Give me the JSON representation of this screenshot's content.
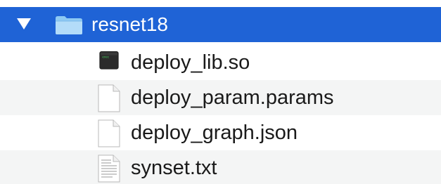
{
  "folder": {
    "name": "resnet18",
    "expanded": true,
    "icon": "folder-icon"
  },
  "files": [
    {
      "name": "deploy_lib.so",
      "icon": "terminal-executable-icon"
    },
    {
      "name": "deploy_param.params",
      "icon": "blank-document-icon"
    },
    {
      "name": "deploy_graph.json",
      "icon": "blank-document-icon"
    },
    {
      "name": "synset.txt",
      "icon": "text-document-icon"
    }
  ],
  "colors": {
    "selection": "#1f63d6",
    "alt_row": "#f4f5f5",
    "folder_icon": "#a9d6f7"
  }
}
